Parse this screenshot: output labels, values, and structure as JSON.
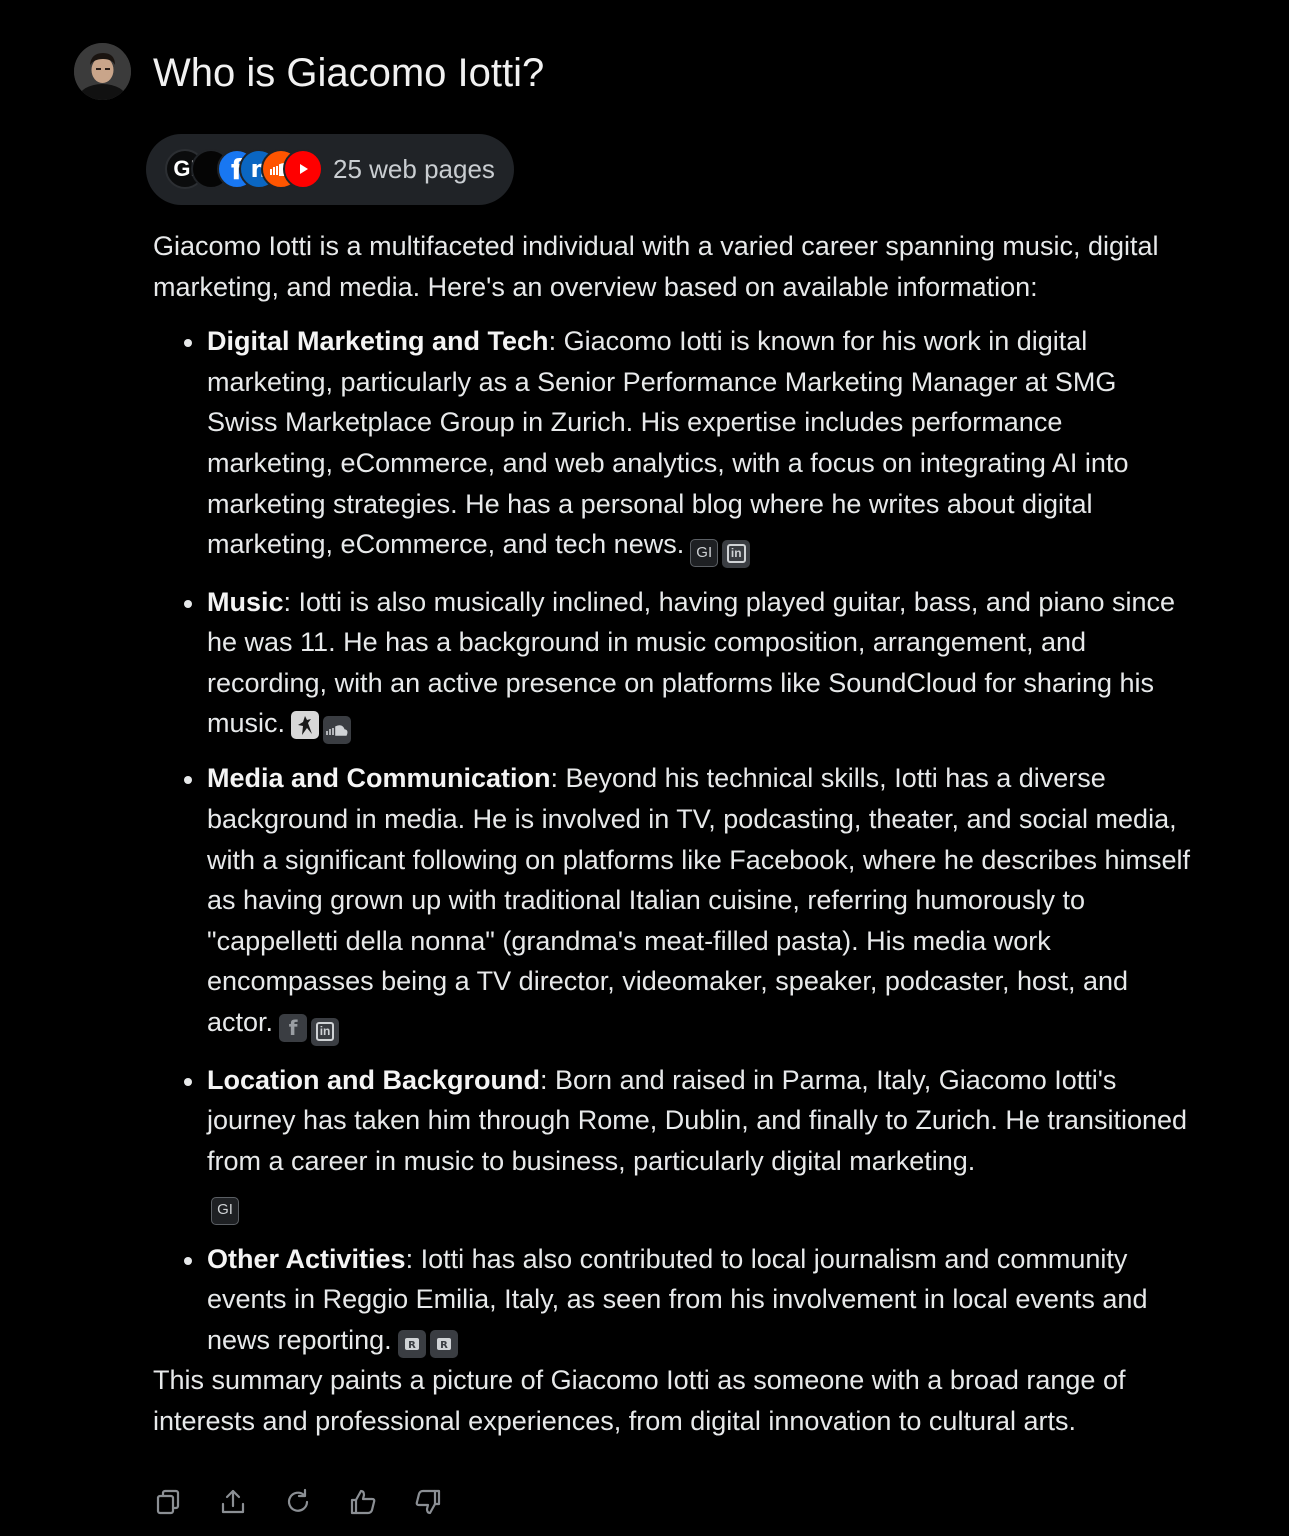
{
  "question": "Who is Giacomo Iotti?",
  "sources": {
    "count_label": "25 web pages",
    "icons": [
      "gi-site-icon",
      "dark-site-icon",
      "facebook-icon",
      "linkedin-icon",
      "soundcloud-icon",
      "youtube-icon"
    ],
    "gi_label": "GI"
  },
  "answer": {
    "intro": "Giacomo Iotti is a multifaceted individual with a varied career spanning music, digital marketing, and media. Here's an overview based on available information:",
    "items": [
      {
        "title": "Digital Marketing and Tech",
        "text": ": Giacomo Iotti is known for his work in digital marketing, particularly as a Senior Performance Marketing Manager at SMG Swiss Marketplace Group in Zurich. His expertise includes performance marketing, eCommerce, and web analytics, with a focus on integrating AI into marketing strategies. He has a personal blog where he writes about digital marketing, eCommerce, and tech news.",
        "citations": [
          "GI",
          "in"
        ]
      },
      {
        "title": "Music",
        "text": ": Iotti is also musically inclined, having played guitar, bass, and piano since he was 11. He has a background in music composition, arrangement, and recording, with an active presence on platforms like SoundCloud for sharing his music.",
        "citations": [
          "music-site-icon",
          "soundcloud-icon"
        ]
      },
      {
        "title": "Media and Communication",
        "text": ": Beyond his technical skills, Iotti has a diverse background in media. He is involved in TV, podcasting, theater, and social media, with a significant following on platforms like Facebook, where he describes himself as having grown up with traditional Italian cuisine, referring humorously to \"cappelletti della nonna\" (grandma's meat-filled pasta). His media work encompasses being a TV director, videomaker, speaker, podcaster, host, and actor.",
        "citations": [
          "f",
          "in"
        ]
      },
      {
        "title": "Location and Background",
        "text": ": Born and raised in Parma, Italy, Giacomo Iotti's journey has taken him through Rome, Dublin, and finally to Zurich. He transitioned from a career in music to business, particularly digital marketing.",
        "citations": [
          "GI"
        ]
      },
      {
        "title": "Other Activities",
        "text": ": Iotti has also contributed to local journalism and community events in Reggio Emilia, Italy, as seen from his involvement in local events and news reporting.",
        "citations": [
          "news-site-icon",
          "news-site-icon"
        ]
      }
    ],
    "summary": "This summary paints a picture of Giacomo Iotti as someone with a broad range of interests and professional experiences, from digital innovation to cultural arts."
  },
  "actions": [
    "copy-icon",
    "share-icon",
    "regenerate-icon",
    "thumbs-up-icon",
    "thumbs-down-icon"
  ],
  "colors": {
    "background": "#000000",
    "text": "#e7e9ea",
    "pill": "#202327",
    "citation": "#3a3d42",
    "facebook": "#1877f2",
    "linkedin": "#0a66c2",
    "soundcloud": "#ff5500",
    "youtube": "#ff0000"
  }
}
